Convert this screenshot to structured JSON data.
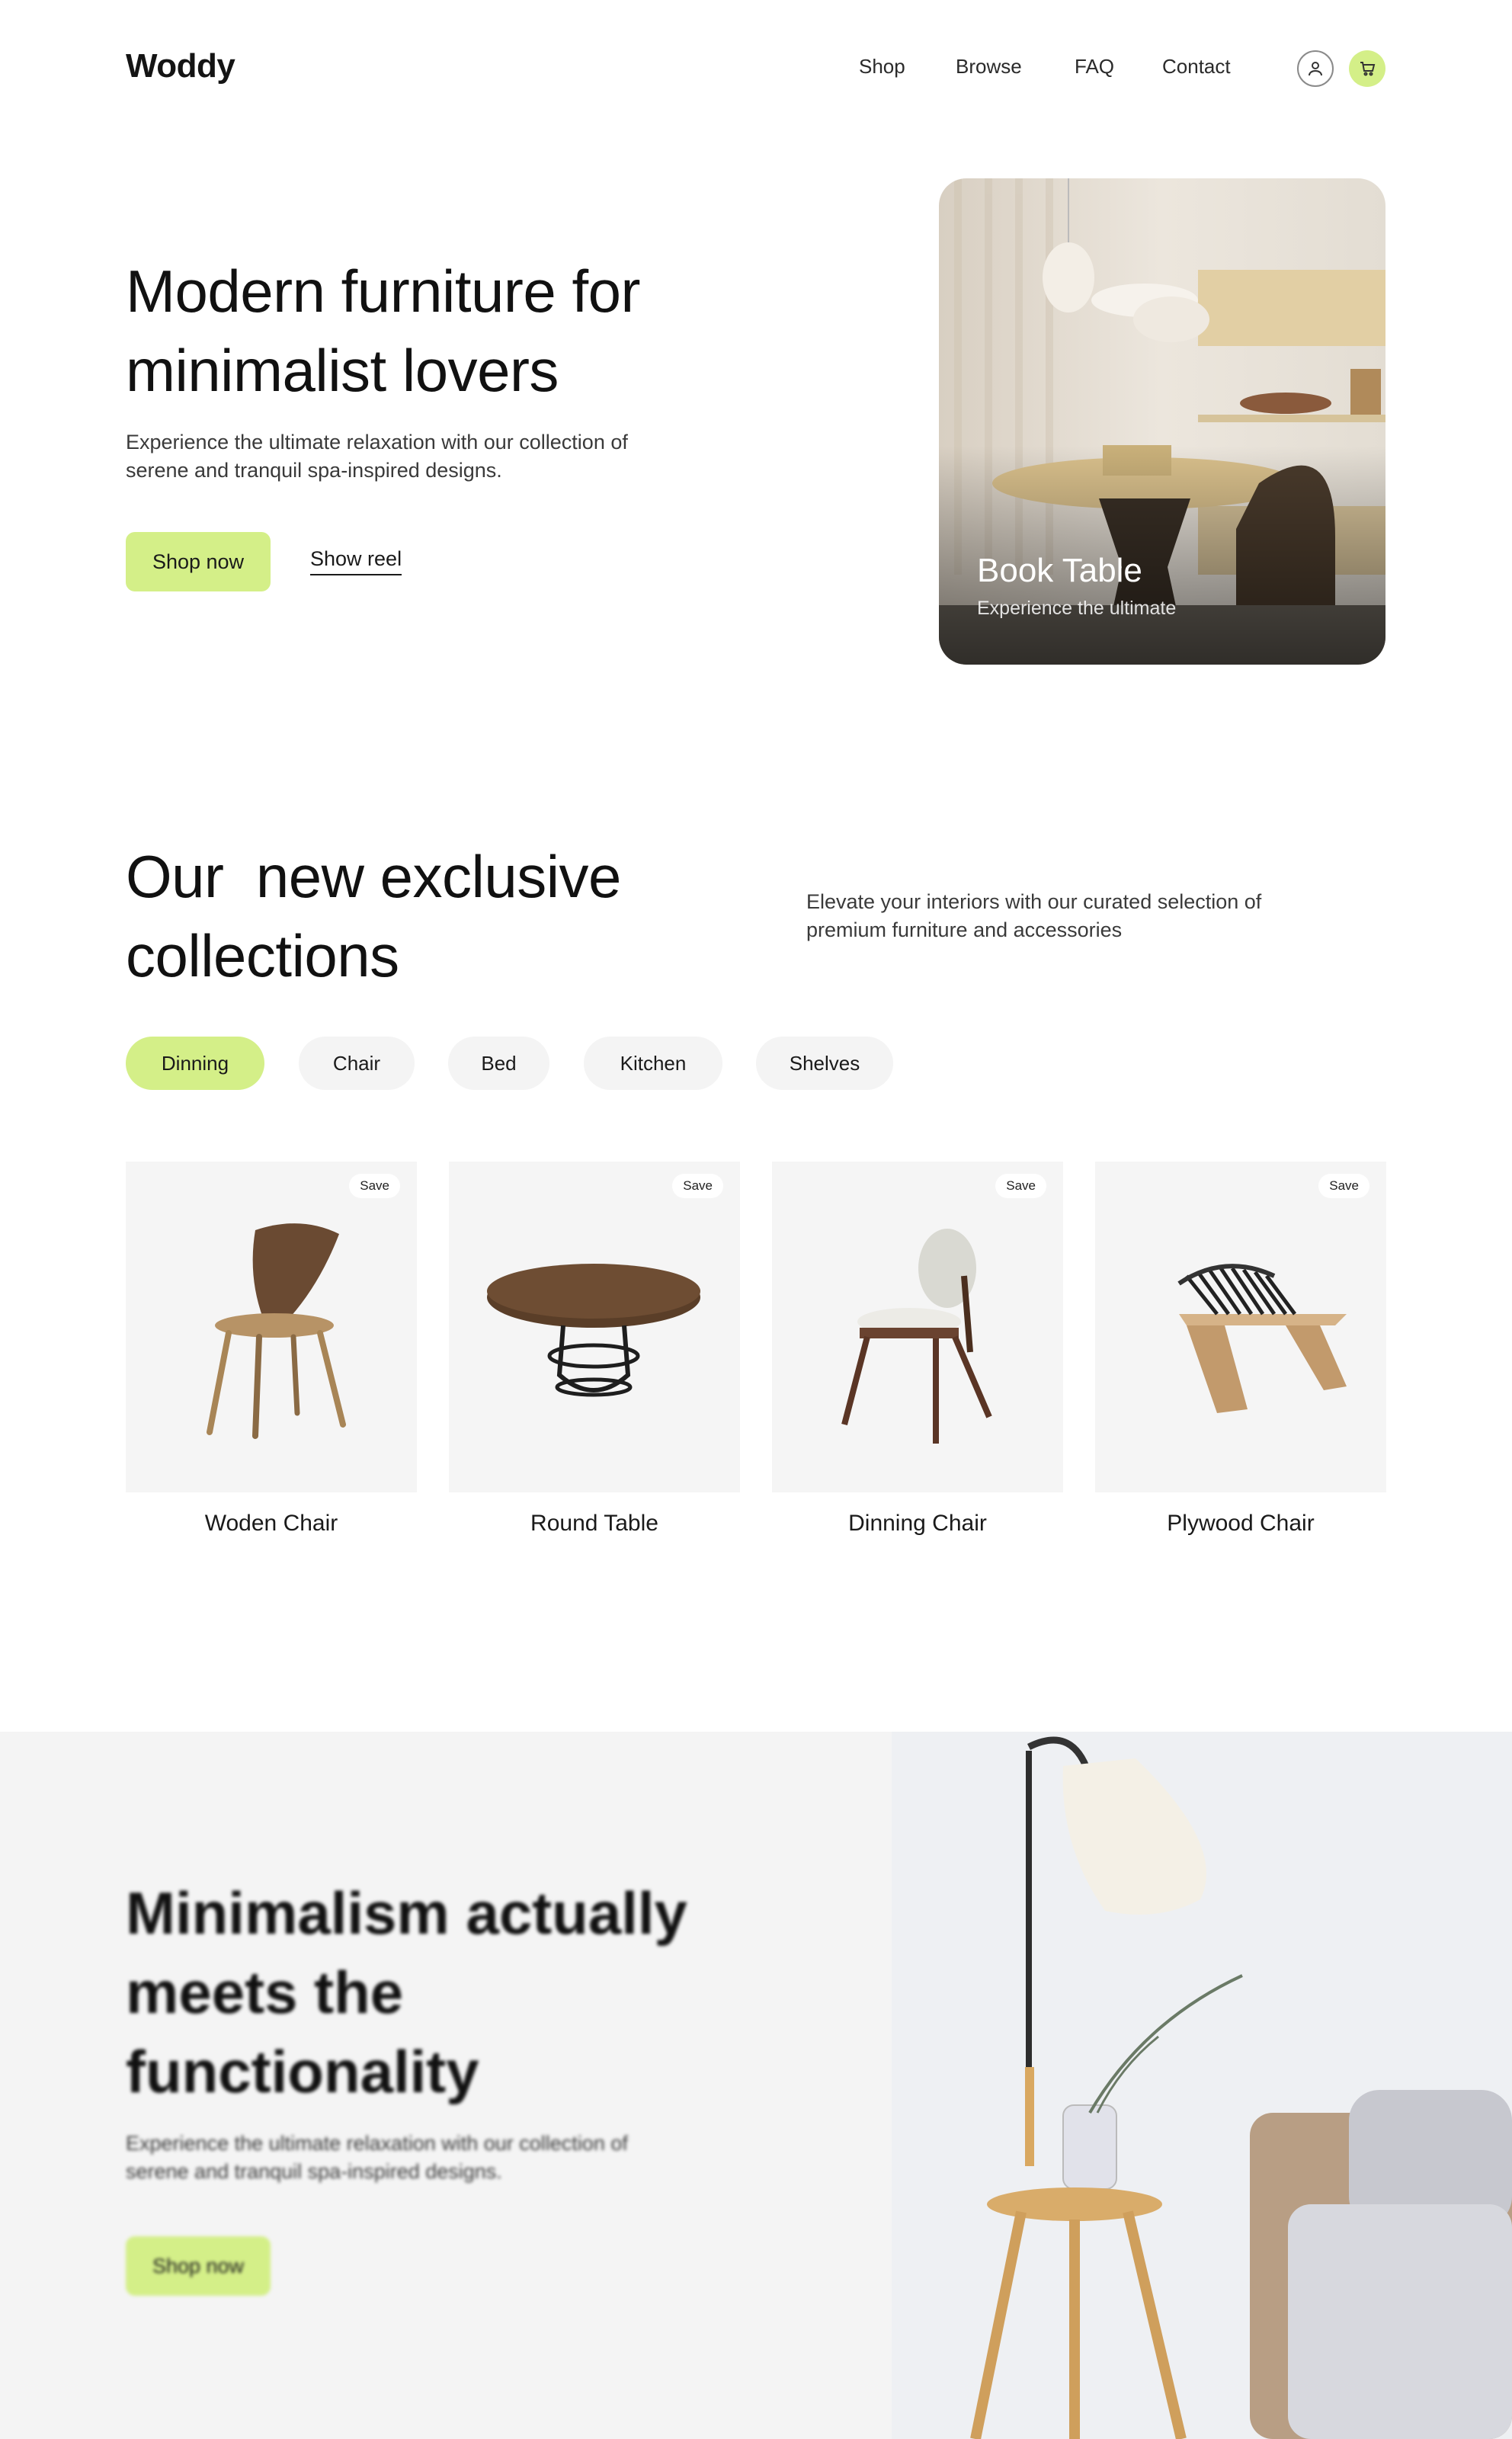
{
  "brand": {
    "logo": "Woddy",
    "accent": "#d4ef88"
  },
  "nav": {
    "items": [
      "Shop",
      "Browse",
      "FAQ",
      "Contact"
    ]
  },
  "header_icons": [
    "user-icon",
    "cart-icon"
  ],
  "hero": {
    "title_line1": "Modern furniture for",
    "title_line2": "minimalist lovers",
    "desc_line1": "Experience the ultimate relaxation with our collection of",
    "desc_line2": "serene and tranquil spa-inspired designs.",
    "primary_button": "Shop now",
    "secondary_link": "Show reel",
    "image_title": "Book Table",
    "image_subtitle": "Experience the ultimate"
  },
  "collections": {
    "title_line1": "Our  new exclusive",
    "title_line2": "collections",
    "desc_line1": "Elevate your interiors with our curated selection of",
    "desc_line2": "premium furniture and accessories",
    "filters": [
      "Dinning",
      "Chair",
      "Bed",
      "Kitchen",
      "Shelves"
    ],
    "active_filter": "Dinning",
    "save_label": "Save",
    "products": [
      {
        "name": "Woden Chair"
      },
      {
        "name": "Round Table"
      },
      {
        "name": "Dinning Chair"
      },
      {
        "name": "Plywood Chair"
      }
    ]
  },
  "feature": {
    "title_line1": "Minimalism actually",
    "title_line2": "meets the",
    "title_line3": "functionality",
    "desc_line1": "Experience the ultimate relaxation with our collection of",
    "desc_line2": "serene and tranquil spa-inspired designs.",
    "button": "Shop now"
  }
}
